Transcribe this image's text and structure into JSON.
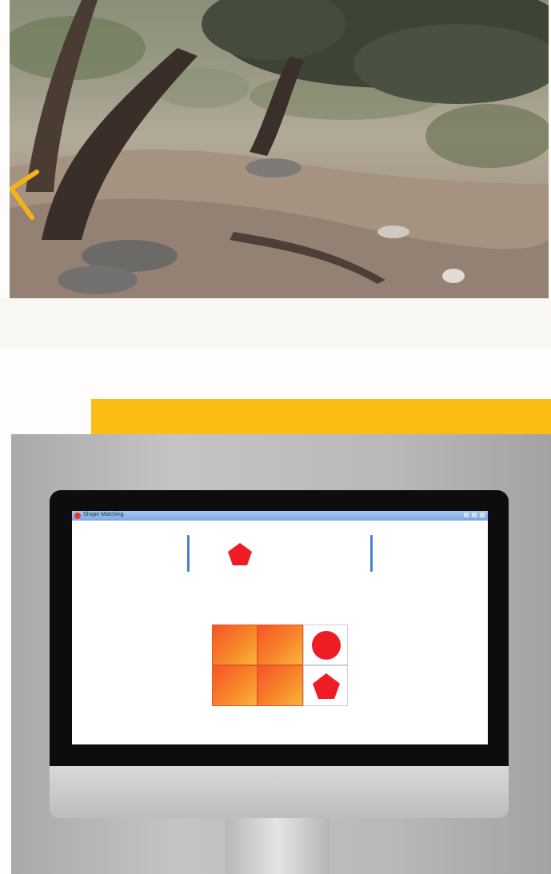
{
  "window": {
    "title": "Shape Matching"
  },
  "colors": {
    "accent_yellow": "#fbbc13",
    "shape_red": "#ee1c24",
    "divider_blue": "#4a7fd8"
  },
  "icons": {
    "back_arrow": "chevron-left-icon"
  }
}
